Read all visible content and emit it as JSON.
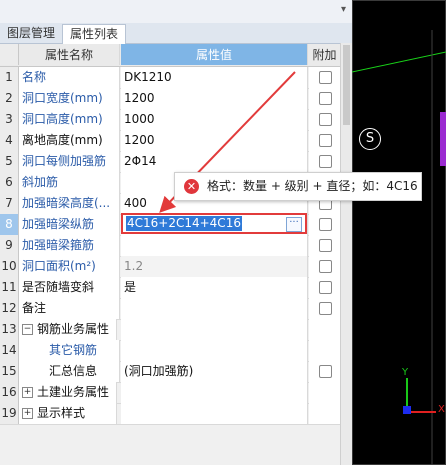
{
  "tabs": [
    {
      "label": "图层管理"
    },
    {
      "label": "属性列表"
    }
  ],
  "grid": {
    "header": {
      "name": "属性名称",
      "value": "属性值",
      "extra": "附加"
    },
    "rows": [
      {
        "num": "1",
        "name": "名称",
        "value": "DK1210"
      },
      {
        "num": "2",
        "name": "洞口宽度(mm)",
        "value": "1200"
      },
      {
        "num": "3",
        "name": "洞口高度(mm)",
        "value": "1000"
      },
      {
        "num": "4",
        "name": "离地高度(mm)",
        "value": "1200"
      },
      {
        "num": "5",
        "name": "洞口每侧加强筋",
        "value": "2Φ14"
      },
      {
        "num": "6",
        "name": "斜加筋",
        "value": ""
      },
      {
        "num": "7",
        "name": "加强暗梁高度(...",
        "value": "400"
      },
      {
        "num": "8",
        "name": "加强暗梁纵筋",
        "value": "4C16+2C14+4C16"
      },
      {
        "num": "9",
        "name": "加强暗梁箍筋",
        "value": ""
      },
      {
        "num": "10",
        "name": "洞口面积(m²)",
        "value": "1.2"
      },
      {
        "num": "11",
        "name": "是否随墙变斜",
        "value": "是"
      },
      {
        "num": "12",
        "name": "备注",
        "value": ""
      },
      {
        "num": "13",
        "name": "钢筋业务属性",
        "value": "",
        "toggle": "−"
      },
      {
        "num": "14",
        "name": "其它钢筋",
        "value": ""
      },
      {
        "num": "15",
        "name": "汇总信息",
        "value": "(洞口加强筋)"
      },
      {
        "num": "16",
        "name": "土建业务属性",
        "value": "",
        "toggle": "+"
      },
      {
        "num": "19",
        "name": "显示样式",
        "value": "",
        "toggle": "+"
      }
    ]
  },
  "tooltip": {
    "icon": "error-icon",
    "symbol": "✕",
    "text": "格式：数量 + 级别 + 直径；如：4C16"
  },
  "editor": {
    "dots": "···"
  },
  "canvas": {
    "marker": "S",
    "axis_y": "Y",
    "axis_x": "X"
  },
  "colors": {
    "accent": "#7fb5e6",
    "error": "#e23b3b",
    "link_text": "#2a5ba8",
    "selection": "#2f7ad8"
  }
}
